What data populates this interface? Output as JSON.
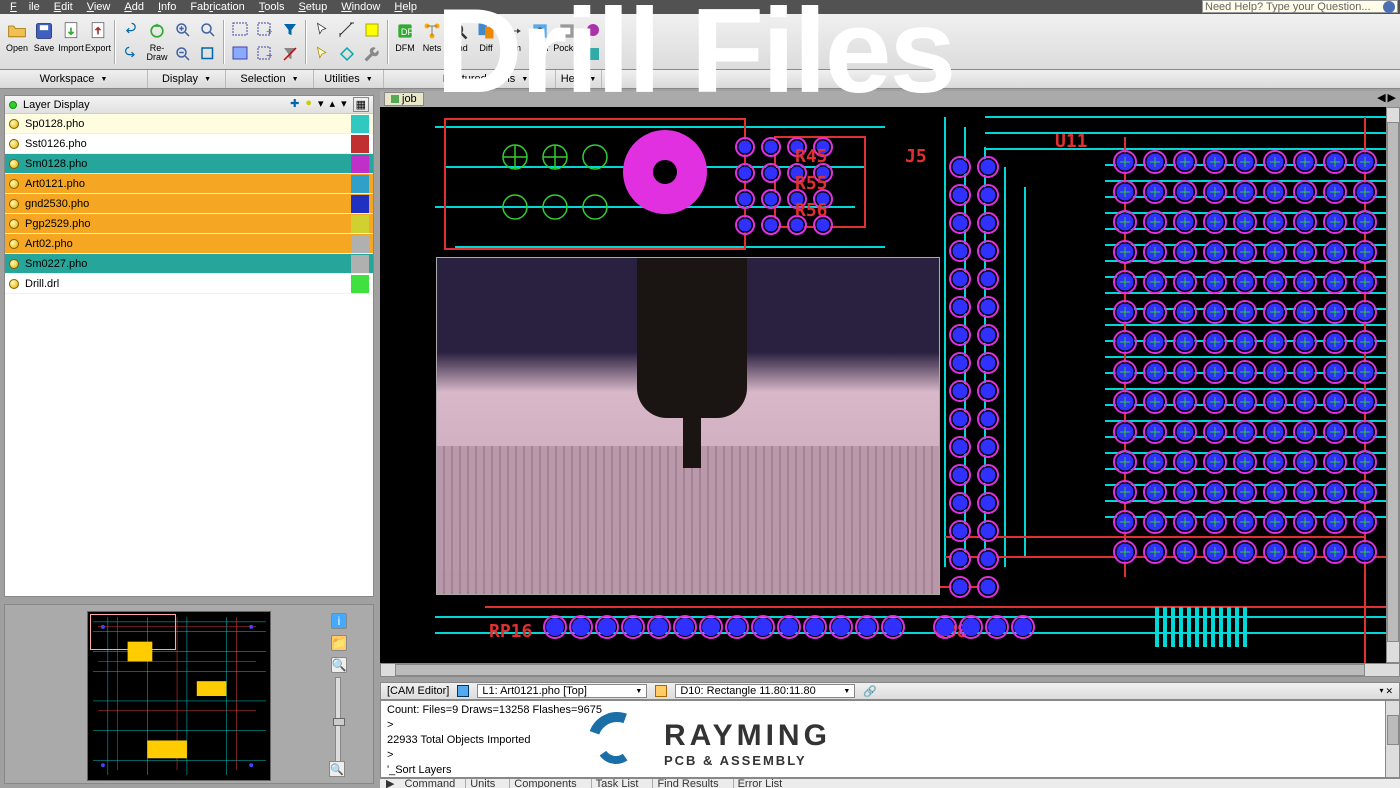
{
  "title_overlay": "Drill Files",
  "menu": [
    "File",
    "Edit",
    "View",
    "Add",
    "Info",
    "Fabrication",
    "Tools",
    "Setup",
    "Window",
    "Help"
  ],
  "help_placeholder": "Need Help? Type your Question...",
  "toolbar": {
    "open": "Open",
    "save": "Save",
    "import": "Import",
    "export": "Export",
    "redraw": "Re-Draw",
    "dfm": "DFM",
    "nets": "Nets",
    "find": "Find",
    "diff": "Diff",
    "dim": "Dim",
    "pocket": "Pocket",
    "pour": "Pour"
  },
  "subbar": {
    "workspace": "Workspace",
    "display": "Display",
    "selection": "Selection",
    "utilities": "Utilities",
    "feat_tools": "Featured Tools",
    "help": "Help"
  },
  "layer_panel": {
    "title": "Layer Display",
    "items": [
      {
        "name": "Sp0128.pho",
        "bg": "sel",
        "color": "#30c8c0"
      },
      {
        "name": "Sst0126.pho",
        "bg": "",
        "color": "#c03030"
      },
      {
        "name": "Sm0128.pho",
        "bg": "teal",
        "color": "#c030c8"
      },
      {
        "name": "Art0121.pho",
        "bg": "orange",
        "color": "#30a0c8"
      },
      {
        "name": "gnd2530.pho",
        "bg": "orange",
        "color": "#2030c0"
      },
      {
        "name": "Pgp2529.pho",
        "bg": "orange",
        "color": "#d0d030"
      },
      {
        "name": "Art02.pho",
        "bg": "orange",
        "color": "#b0b0b0"
      },
      {
        "name": "Sm0227.pho",
        "bg": "teal",
        "color": "#b0b0b0"
      },
      {
        "name": "Drill.drl",
        "bg": "",
        "color": "#40e040"
      }
    ]
  },
  "canvas": {
    "tab": "job"
  },
  "info": {
    "editor": "[CAM Editor]",
    "layer": "L1: Art0121.pho  [Top]",
    "aperture": "D10: Rectangle 11.80:11.80"
  },
  "output": {
    "line1": "Count: Files=9 Draws=13258 Flashes=9675",
    "line2": ">",
    "line3": "22933 Total Objects Imported",
    "line4": ">",
    "line5": "'_Sort Layers",
    "line6": ">"
  },
  "cmd": {
    "prompt": "Command",
    "tabs": [
      "Units",
      "Components",
      "Task List",
      "Find Results",
      "Error List"
    ]
  },
  "refdes": {
    "r45": "R45",
    "r55": "R55",
    "r56": "R56",
    "j5": "J5",
    "u11": "U11",
    "rp16": "RP16",
    "c38": "C38"
  },
  "rayming": {
    "t1": "RAYMING",
    "t2": "PCB & ASSEMBLY"
  }
}
